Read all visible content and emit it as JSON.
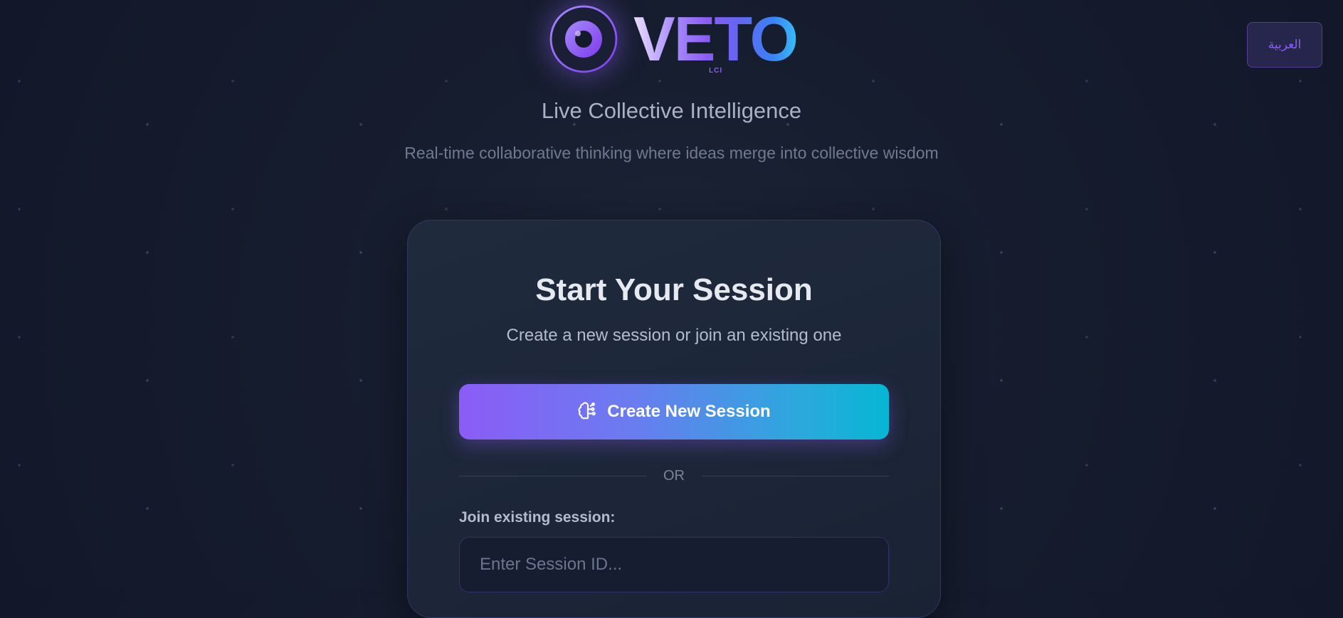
{
  "language_toggle": {
    "label": "العربية"
  },
  "brand": {
    "name": "VETO",
    "sub": "LCI",
    "icon": "eye-icon"
  },
  "hero": {
    "tagline": "Live Collective Intelligence",
    "description": "Real-time collaborative thinking where ideas merge into collective wisdom"
  },
  "session_card": {
    "title": "Start Your Session",
    "subtitle": "Create a new session or join an existing one",
    "create_button": {
      "label": "Create New Session",
      "icon": "brain-icon"
    },
    "divider_text": "OR",
    "join_label": "Join existing session:",
    "session_input": {
      "placeholder": "Enter Session ID...",
      "value": ""
    }
  },
  "colors": {
    "accent_purple": "#8b5cf6",
    "accent_cyan": "#06b6d4",
    "background": "#161d2e"
  }
}
